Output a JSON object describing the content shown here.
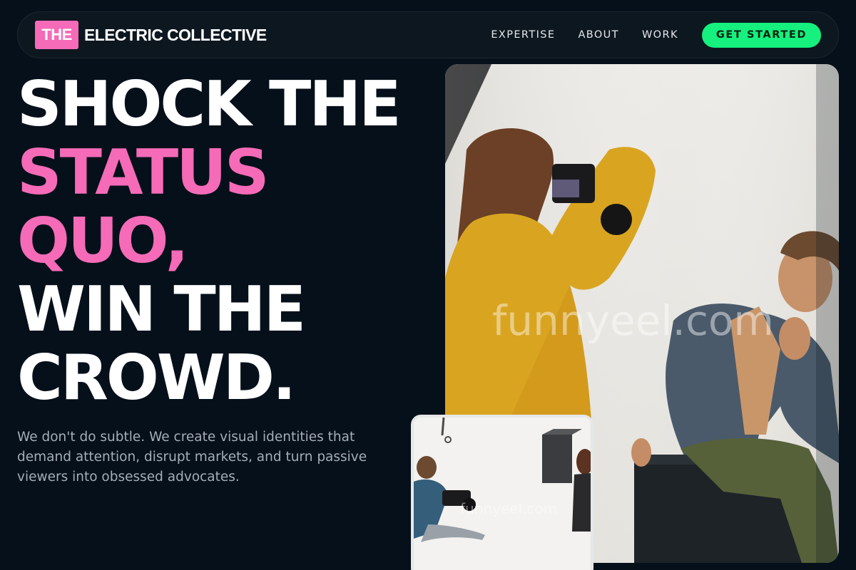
{
  "nav": {
    "logo_badge": "THE",
    "logo_text": "ELECTRIC COLLECTIVE",
    "links": [
      "EXPERTISE",
      "ABOUT",
      "WORK"
    ],
    "cta_label": "GET STARTED"
  },
  "hero": {
    "headline_lines": [
      "SHOCK THE",
      "STATUS",
      "QUO,",
      "WIN THE",
      "CROWD."
    ],
    "lede": "We don't do subtle. We create visual identities that demand attention, disrupt markets, and turn passive viewers into obsessed advocates."
  },
  "images": {
    "main_watermark": "funnyeel.com",
    "small_watermark": "funnyeel.com"
  },
  "colors": {
    "background": "#06101a",
    "accent_pink": "#f56bb8",
    "accent_green": "#15f07e"
  }
}
